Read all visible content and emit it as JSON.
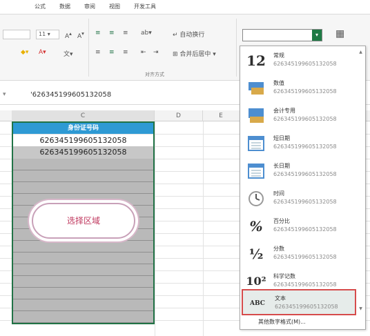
{
  "ribbon_tabs": [
    "公式",
    "数据",
    "审阅",
    "视图",
    "开发工具"
  ],
  "ribbon": {
    "font_size": "11",
    "wrap_text": "自动换行",
    "merge_center": "合并后居中",
    "alignment_group": "对齐方式"
  },
  "formula_bar": {
    "value": "'626345199605132058"
  },
  "columns": [
    "C",
    "D",
    "E"
  ],
  "sheet": {
    "header_cell": "身份证号码",
    "cells": [
      "626345199605132058",
      "626345199605132058"
    ],
    "callout": "选择区域"
  },
  "number_format": {
    "current": "",
    "items": [
      {
        "icon": "12",
        "name": "常规",
        "sample": "626345199605132058"
      },
      {
        "icon": "currency",
        "name": "数值",
        "sample": "626345199605132058"
      },
      {
        "icon": "accounting",
        "name": "会计专用",
        "sample": "626345199605132058"
      },
      {
        "icon": "short-date",
        "name": "短日期",
        "sample": "626345199605132058"
      },
      {
        "icon": "long-date",
        "name": "长日期",
        "sample": "626345199605132058"
      },
      {
        "icon": "clock",
        "name": "时间",
        "sample": "626345199605132058"
      },
      {
        "icon": "%",
        "name": "百分比",
        "sample": "626345199605132058"
      },
      {
        "icon": "½",
        "name": "分数",
        "sample": "626345199605132058"
      },
      {
        "icon": "10²",
        "name": "科学记数",
        "sample": "626345199605132058"
      },
      {
        "icon": "ABC",
        "name": "文本",
        "sample": "626345199605132058"
      }
    ],
    "more_formats": "其他数字格式(M)..."
  },
  "colors": {
    "header_fill": "#2e9ad4",
    "selection_border": "#217346",
    "highlight_border": "#d64b4b"
  }
}
